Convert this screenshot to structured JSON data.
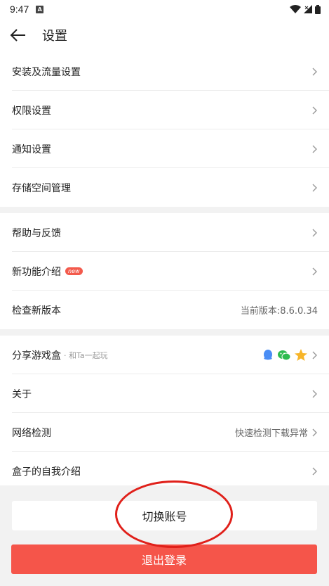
{
  "status_bar": {
    "time": "9:47",
    "notif_icon": "A"
  },
  "header": {
    "title": "设置"
  },
  "groups": [
    {
      "items": [
        {
          "label": "安装及流量设置"
        },
        {
          "label": "权限设置"
        },
        {
          "label": "通知设置"
        },
        {
          "label": "存储空间管理"
        }
      ]
    },
    {
      "items": [
        {
          "label": "帮助与反馈"
        },
        {
          "label": "新功能介绍",
          "badge": "new"
        },
        {
          "label": "检查新版本",
          "value": "当前版本:8.6.0.34"
        }
      ]
    },
    {
      "items": [
        {
          "label": "分享游戏盒",
          "sub": "· 和Ta一起玩"
        },
        {
          "label": "关于"
        },
        {
          "label": "网络检测",
          "value": "快速检测下载异常"
        },
        {
          "label": "盒子的自我介绍"
        }
      ]
    }
  ],
  "buttons": {
    "switch_account": "切换账号",
    "logout": "退出登录"
  },
  "colors": {
    "accent": "#f5554a",
    "annotation": "#e0201a"
  }
}
